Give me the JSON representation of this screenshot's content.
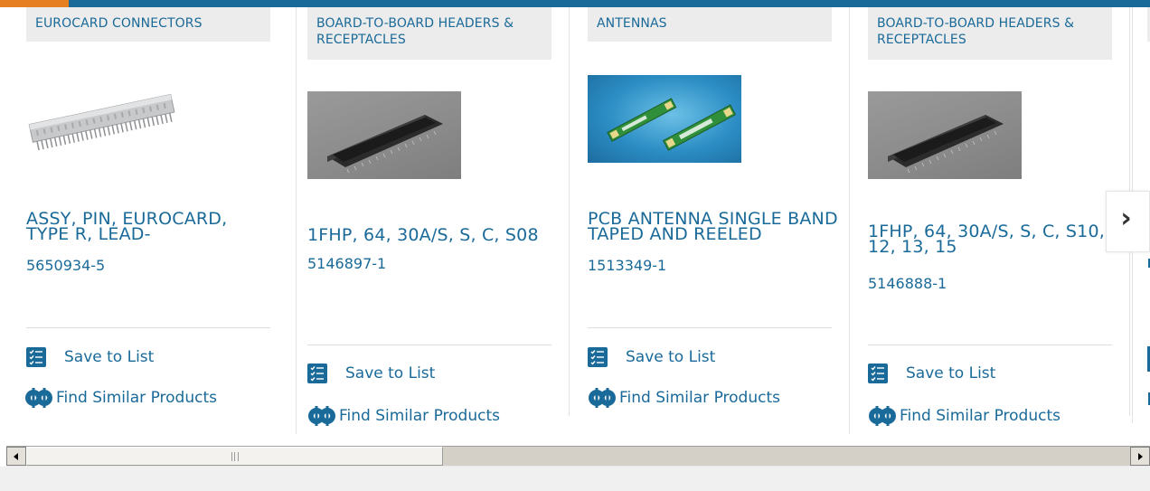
{
  "colors": {
    "brand_blue": "#1a6a99",
    "accent_orange": "#e67e22",
    "category_bg": "#ececec"
  },
  "products": [
    {
      "category": "EUROCARD CONNECTORS",
      "name": "ASSY, PIN, EUROCARD, TYPE R, LEAD-",
      "part_number": "5650934-5",
      "image_icon": "eurocard-connector-photo"
    },
    {
      "category": "BOARD-TO-BOARD HEADERS & RECEPTACLES",
      "name": "1FHP, 64, 30A/S, S, C, S08",
      "part_number": "5146897-1",
      "image_icon": "board-header-photo"
    },
    {
      "category": "ANTENNAS",
      "name": "PCB ANTENNA SINGLE BAND TAPED AND REELED",
      "part_number": "1513349-1",
      "image_icon": "pcb-antenna-photo"
    },
    {
      "category": "BOARD-TO-BOARD HEADERS & RECEPTACLES",
      "name": "1FHP, 64, 30A/S, S, C, S10, 12, 13, 15",
      "part_number": "5146888-1",
      "image_icon": "board-header-photo"
    }
  ],
  "actions": {
    "save_to_list": "Save to List",
    "find_similar": "Find Similar Products"
  },
  "carousel": {
    "next_icon": "chevron-right-icon"
  },
  "scrollbar": {
    "left_icon": "triangle-left-icon",
    "right_icon": "triangle-right-icon"
  }
}
